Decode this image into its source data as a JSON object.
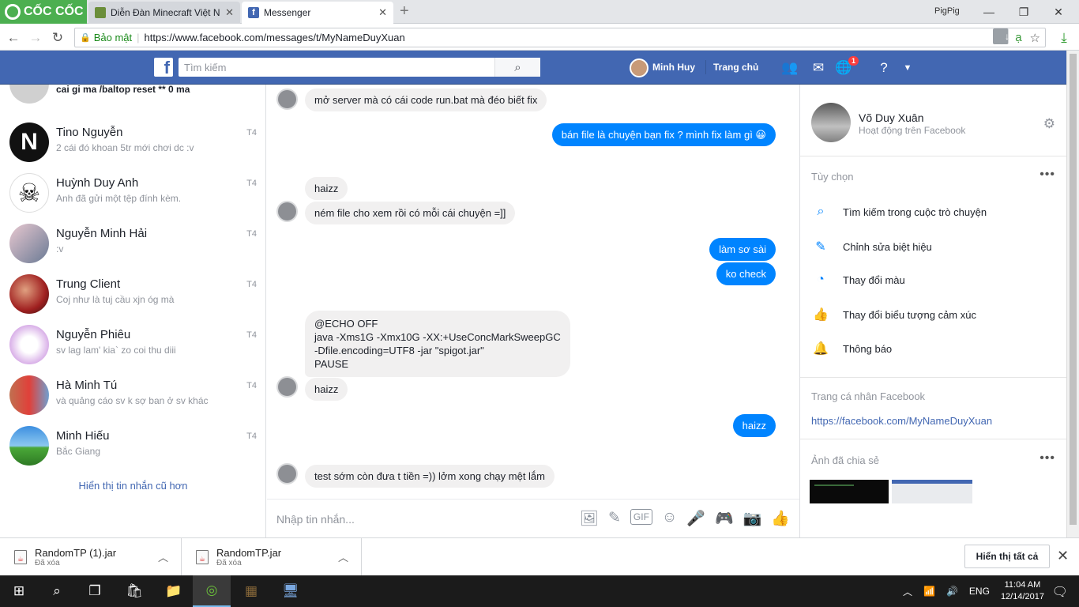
{
  "browser": {
    "brand": "CỐC CỐC",
    "tabs": [
      {
        "title": "Diễn Đàn Minecraft Việt N"
      },
      {
        "title": "Messenger"
      }
    ],
    "profile": "PigPig",
    "security_label": "Bảo mật",
    "url": "https://www.facebook.com/messages/t/MyNameDuyXuan"
  },
  "fb": {
    "logo": "f",
    "search_placeholder": "Tìm kiếm",
    "user_name": "Minh Huy",
    "home_label": "Trang chủ",
    "notif_count": "1"
  },
  "conversations": [
    {
      "name": "",
      "preview": "cai gi ma /baltop reset ** 0 ma",
      "time": ""
    },
    {
      "name": "Tino Nguyễn",
      "preview": "2 cái đó khoan 5tr mới chơi dc :v",
      "time": "T4"
    },
    {
      "name": "Huỳnh Duy Anh",
      "preview": "Anh đã gửi một tệp đính kèm.",
      "time": "T4"
    },
    {
      "name": "Nguyễn Minh Hải",
      "preview": ":v",
      "time": "T4"
    },
    {
      "name": "Trung Client",
      "preview": "Coj như là tuj cầu xjn óg mà",
      "time": "T4"
    },
    {
      "name": "Nguyễn Phiêu",
      "preview": "sv lag lam' kia` zo coi thu diii",
      "time": "T4"
    },
    {
      "name": "Hà Minh Tú",
      "preview": "và quảng cáo sv k sợ ban ở sv khác",
      "time": "T4"
    },
    {
      "name": "Minh Hiếu",
      "preview": "Bắc Giang",
      "time": "T4"
    }
  ],
  "older_link": "Hiển thị tin nhắn cũ hơn",
  "messages": [
    {
      "dir": "in",
      "text": "mở server mà có cái code run.bat mà đéo biết fix"
    },
    {
      "dir": "out",
      "text": "bán file là chuyện bạn fix ? mình fix làm gì 😀"
    },
    {
      "dir": "in",
      "text": "haizz"
    },
    {
      "dir": "in",
      "text": "ném file cho xem rồi có mỗi cái chuyện =]]"
    },
    {
      "dir": "out",
      "text": "làm sơ sài"
    },
    {
      "dir": "out",
      "text": "ko check"
    },
    {
      "dir": "in",
      "lines": [
        "@ECHO OFF",
        "java -Xms1G -Xmx10G -XX:+UseConcMarkSweepGC",
        "-Dfile.encoding=UTF8 -jar \"spigot.jar\"",
        "PAUSE"
      ]
    },
    {
      "dir": "in",
      "text": "haizz"
    },
    {
      "dir": "out",
      "text": "haizz"
    },
    {
      "dir": "in",
      "text": "test sớm còn đưa t tiền =)) lởm xong chạy mệt lắm"
    }
  ],
  "composer_placeholder": "Nhập tin nhắn...",
  "composer_gif": "GIF",
  "contact": {
    "name": "Võ Duy Xuân",
    "status": "Hoạt động trên Facebook"
  },
  "options": {
    "title": "Tùy chọn",
    "items": [
      {
        "label": "Tìm kiếm trong cuộc trò chuyện"
      },
      {
        "label": "Chỉnh sửa biệt hiệu"
      },
      {
        "label": "Thay đổi màu"
      },
      {
        "label": "Thay đổi biểu tượng cảm xúc"
      },
      {
        "label": "Thông báo"
      }
    ]
  },
  "profile_section": {
    "title": "Trang cá nhân Facebook",
    "link": "https://facebook.com/MyNameDuyXuan"
  },
  "shared_photos_title": "Ảnh đã chia sẻ",
  "downloads": [
    {
      "name": "RandomTP (1).jar",
      "status": "Đã xóa"
    },
    {
      "name": "RandomTP.jar",
      "status": "Đã xóa"
    }
  ],
  "show_all": "Hiển thị tất cả",
  "taskbar": {
    "lang": "ENG",
    "time": "11:04 AM",
    "date": "12/14/2017"
  }
}
